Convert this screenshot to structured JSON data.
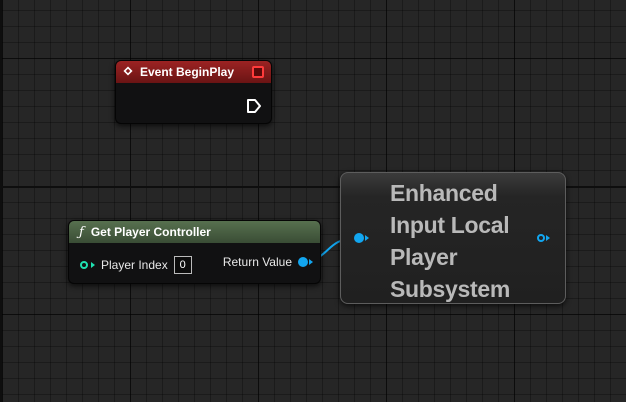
{
  "event_node": {
    "title": "Event BeginPlay",
    "header_color": "#8a1d1d",
    "icon": "event-diamond-icon"
  },
  "get_player_controller": {
    "title": "Get Player Controller",
    "icon": "function-icon",
    "header_color": "#4f6647",
    "input_label": "Player Index",
    "input_value": "0",
    "output_label": "Return Value"
  },
  "subsystem_node": {
    "title_lines": [
      "Enhanced",
      "Input Local",
      "Player",
      "Subsystem"
    ]
  },
  "colors": {
    "object_pin": "#12a6f0",
    "int_pin": "#1fe0b0",
    "delegate_pin": "#ff3b3b"
  }
}
